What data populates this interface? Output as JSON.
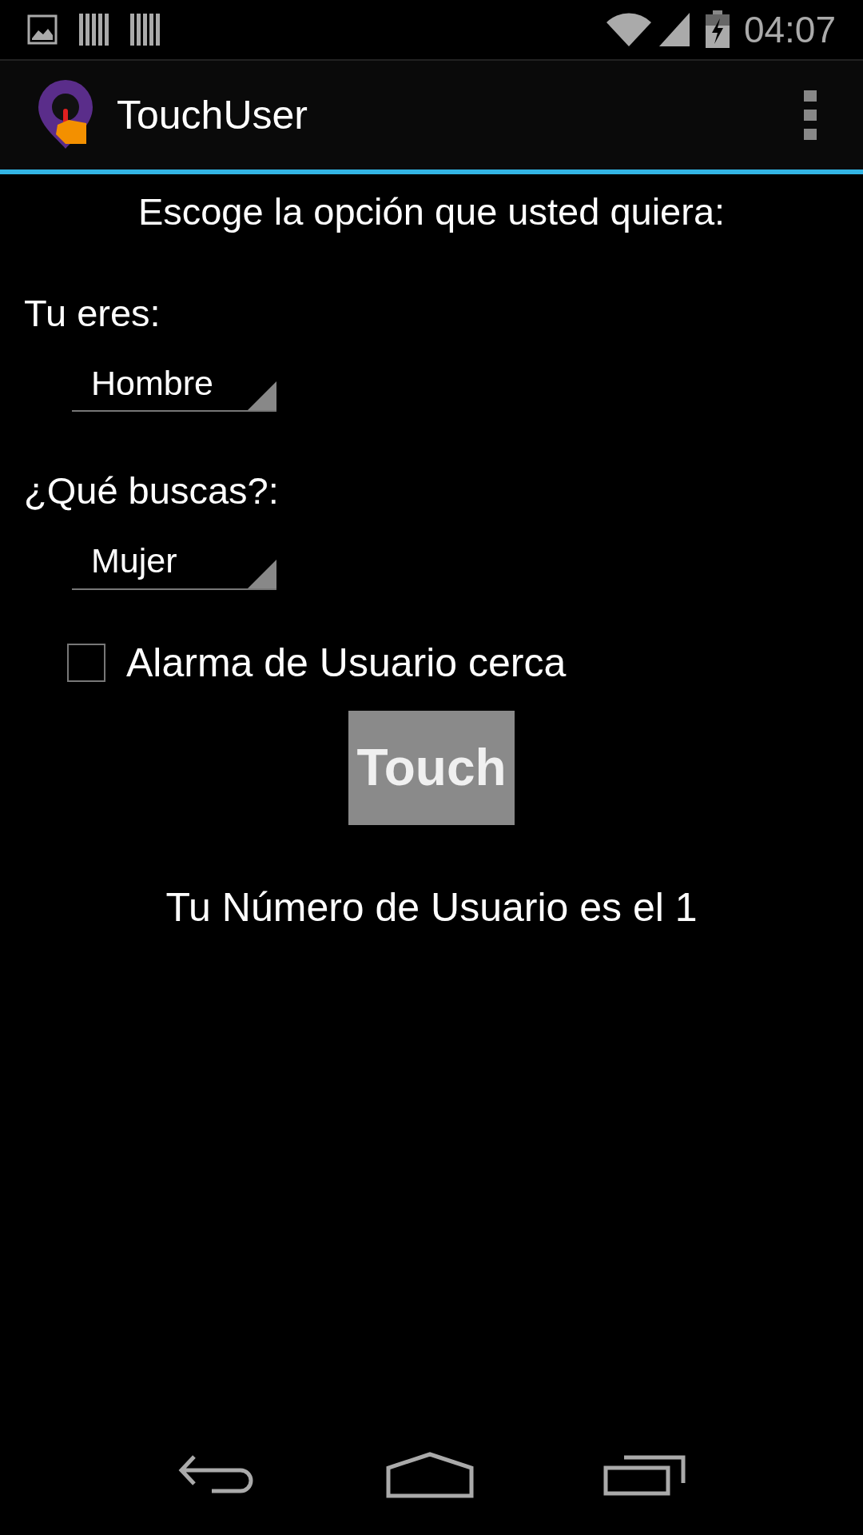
{
  "status_bar": {
    "time": "04:07"
  },
  "app_bar": {
    "title": "TouchUser"
  },
  "heading": "Escoge la opción que usted quiera:",
  "fields": [
    {
      "label": "Tu eres:",
      "value": "Hombre"
    },
    {
      "label": "¿Qué buscas?:",
      "value": "Mujer"
    }
  ],
  "checkbox": {
    "label": "Alarma de Usuario cerca",
    "checked": false
  },
  "button": {
    "label": "Touch"
  },
  "result": "Tu Número de Usuario es el 1"
}
